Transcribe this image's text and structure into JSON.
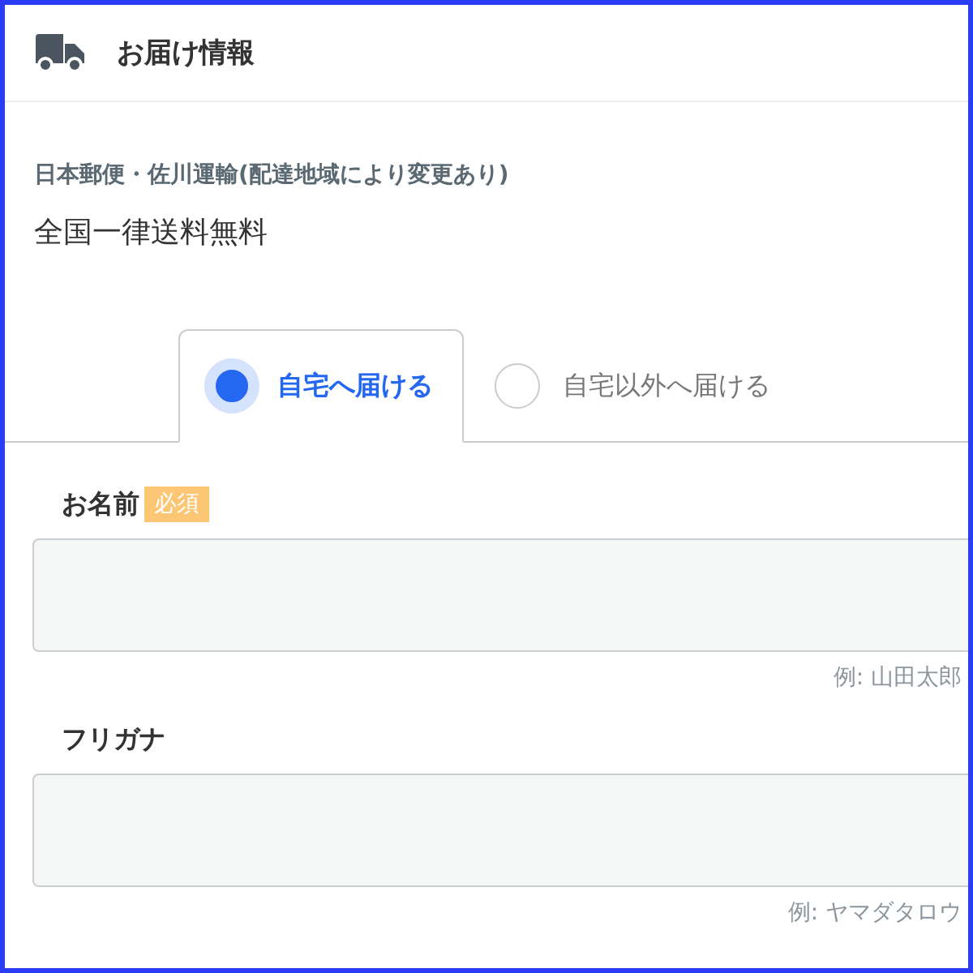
{
  "header": {
    "title": "お届け情報"
  },
  "carrier": "日本郵便・佐川運輸(配達地域により変更あり)",
  "shipping_note": "全国一律送料無料",
  "delivery_tabs": [
    {
      "label": "自宅へ届ける",
      "selected": true
    },
    {
      "label": "自宅以外へ届ける",
      "selected": false
    }
  ],
  "fields": [
    {
      "label": "お名前",
      "badge": "必須",
      "hint": "例: 山田太郎"
    },
    {
      "label": "フリガナ",
      "hint": "例: ヤマダタロウ"
    }
  ]
}
